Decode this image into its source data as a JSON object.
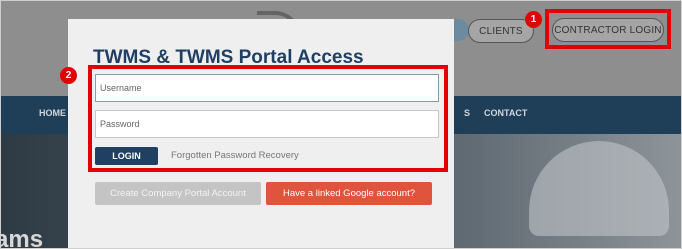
{
  "site": {
    "top_buttons": {
      "blue_pill": "",
      "clients": "CLIENTS",
      "contractor_login": "CONTRACTOR LOGIN"
    },
    "nav": {
      "home_partial": "HOME",
      "s_partial": "S",
      "contact": "CONTACT"
    },
    "hero_partial_text": "ams"
  },
  "modal": {
    "title": "TWMS & TWMS Portal Access",
    "username_placeholder": "Username",
    "password_placeholder": "Password",
    "login_label": "LOGIN",
    "forgot_label": "Forgotten Password Recovery",
    "create_account_label": "Create Company Portal Account",
    "google_label": "Have a linked Google account?"
  },
  "annotations": {
    "marker_1": "1",
    "marker_2": "2",
    "highlight_color": "#e30000"
  },
  "colors": {
    "brand_blue": "#1f3f63",
    "google_red": "#e0533c",
    "nav_bg": "#1f3f58"
  }
}
